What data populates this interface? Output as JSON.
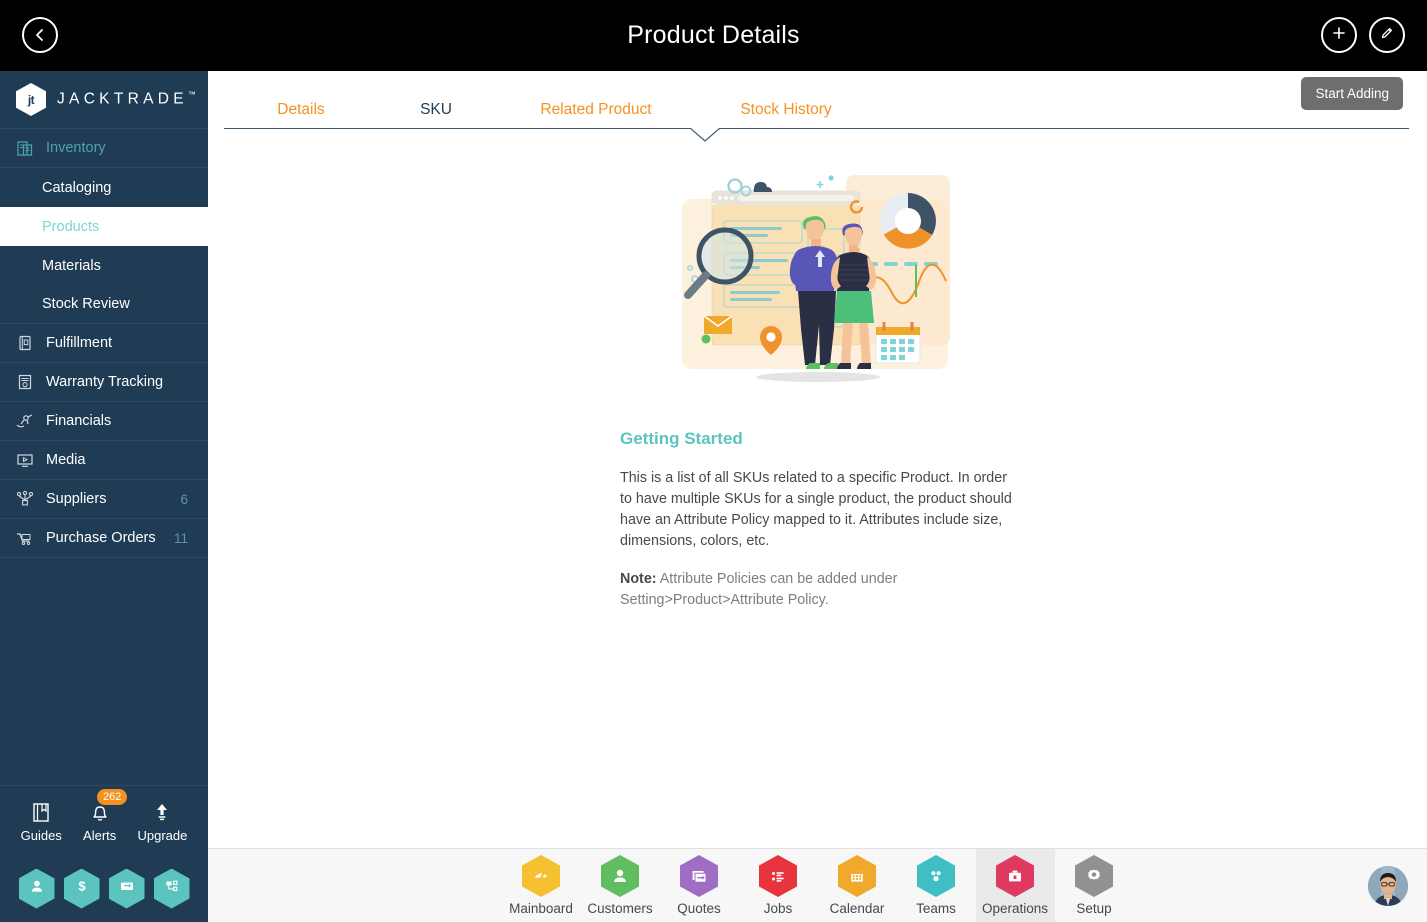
{
  "topbar": {
    "title": "Product Details",
    "back_icon": "chevron-left-icon",
    "add_icon": "plus-icon",
    "edit_icon": "pencil-icon"
  },
  "sidebar": {
    "logo_text": "JACKTRADE",
    "logo_tm": "™",
    "logo_monogram": "jt",
    "items": [
      {
        "label": "Inventory",
        "icon": "inventory-icon",
        "type": "group",
        "badge": ""
      },
      {
        "label": "Cataloging",
        "icon": "",
        "type": "sub",
        "badge": ""
      },
      {
        "label": "Products",
        "icon": "",
        "type": "sub",
        "badge": "",
        "active": true
      },
      {
        "label": "Materials",
        "icon": "",
        "type": "sub",
        "badge": ""
      },
      {
        "label": "Stock Review",
        "icon": "",
        "type": "sub",
        "badge": ""
      },
      {
        "label": "Fulfillment",
        "icon": "fulfillment-icon",
        "type": "item",
        "badge": ""
      },
      {
        "label": "Warranty Tracking",
        "icon": "warranty-icon",
        "type": "item",
        "badge": ""
      },
      {
        "label": "Financials",
        "icon": "financials-icon",
        "type": "item",
        "badge": ""
      },
      {
        "label": "Media",
        "icon": "media-icon",
        "type": "item",
        "badge": ""
      },
      {
        "label": "Suppliers",
        "icon": "suppliers-icon",
        "type": "item",
        "badge": "6"
      },
      {
        "label": "Purchase Orders",
        "icon": "purchase-orders-icon",
        "type": "item",
        "badge": "11"
      }
    ],
    "tools": [
      {
        "label": "Guides",
        "icon": "book-icon",
        "badge": ""
      },
      {
        "label": "Alerts",
        "icon": "bell-icon",
        "badge": "262"
      },
      {
        "label": "Upgrade",
        "icon": "arrow-up-icon",
        "badge": ""
      }
    ],
    "quick_hexes": [
      {
        "icon": "person-icon",
        "color": "#5bc4bf"
      },
      {
        "icon": "dollar-icon",
        "color": "#5bc4bf"
      },
      {
        "icon": "payment-icon",
        "color": "#5bc4bf"
      },
      {
        "icon": "workflow-icon",
        "color": "#5bc4bf"
      }
    ],
    "accent_color": "#4ba3b0",
    "bg_color": "#203c55"
  },
  "tabs": {
    "items": [
      {
        "label": "Details",
        "active": false
      },
      {
        "label": "SKU",
        "active": true
      },
      {
        "label": "Related Product",
        "active": false
      },
      {
        "label": "Stock History",
        "active": false
      }
    ],
    "inactive_color": "#f59120",
    "active_color": "#203c55"
  },
  "toolbar": {
    "start_adding_label": "Start Adding"
  },
  "content": {
    "illustration": "sku-getting-started-illustration",
    "heading": "Getting Started",
    "paragraph": "This is a list of all SKUs related to a specific Product. In order to have multiple SKUs for a single product, the product should have an Attribute Policy mapped to it. Attributes include size, dimensions, colors, etc.",
    "note_label": "Note:",
    "note_text": " Attribute Policies can be added under Setting>Product>Attribute Policy.",
    "heading_color": "#5bc4bf"
  },
  "bottomnav": {
    "items": [
      {
        "label": "Mainboard",
        "icon": "mainboard-icon",
        "color": "#f5c131",
        "active": false
      },
      {
        "label": "Customers",
        "icon": "customers-icon",
        "color": "#60bd60",
        "active": false
      },
      {
        "label": "Quotes",
        "icon": "quotes-icon",
        "color": "#a06dc4",
        "active": false
      },
      {
        "label": "Jobs",
        "icon": "jobs-icon",
        "color": "#e8343f",
        "active": false
      },
      {
        "label": "Calendar",
        "icon": "calendar-icon",
        "color": "#f0a92b",
        "active": false
      },
      {
        "label": "Teams",
        "icon": "teams-icon",
        "color": "#3fbfc4",
        "active": false
      },
      {
        "label": "Operations",
        "icon": "operations-icon",
        "color": "#e0395f",
        "active": true
      },
      {
        "label": "Setup",
        "icon": "gear-icon",
        "color": "#8f9193",
        "active": false
      }
    ],
    "avatar": "user-avatar"
  }
}
